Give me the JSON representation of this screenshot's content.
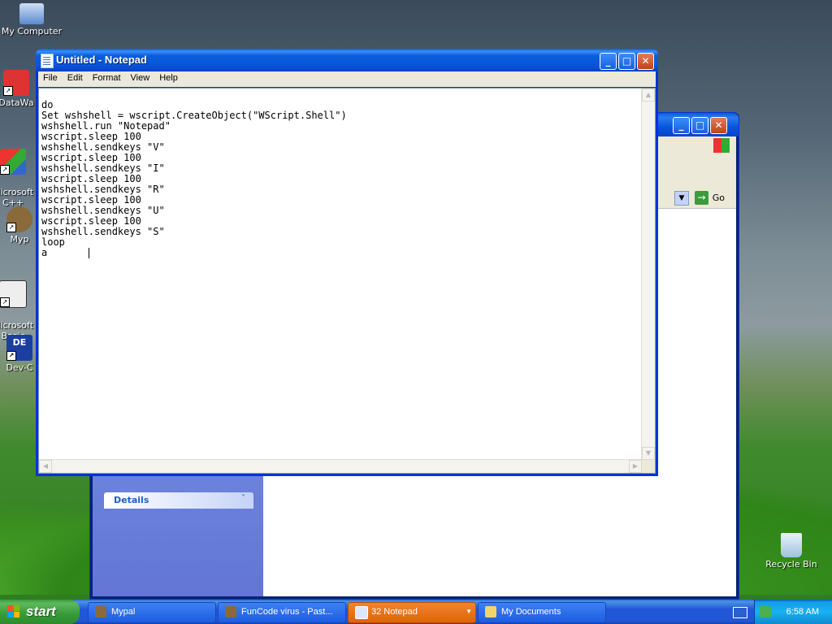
{
  "desktop": {
    "icons": [
      {
        "label": "My Computer"
      },
      {
        "label": "DataWa"
      },
      {
        "label": "Microsoft\nC++"
      },
      {
        "label": "Myp"
      },
      {
        "label": "Microsoft\nBasic"
      },
      {
        "label": "Dev-C"
      },
      {
        "label": "Recycle Bin"
      }
    ]
  },
  "background_window": {
    "address_go": "Go",
    "details_label": "Details"
  },
  "notepad": {
    "title": "Untitled - Notepad",
    "menu": [
      "File",
      "Edit",
      "Format",
      "View",
      "Help"
    ],
    "text": "do\nSet wshshell = wscript.CreateObject(\"WScript.Shell\")\nwshshell.run \"Notepad\"\nwscript.sleep 100\nwshshell.sendkeys \"V\"\nwscript.sleep 100\nwshshell.sendkeys \"I\"\nwscript.sleep 100\nwshshell.sendkeys \"R\"\nwscript.sleep 100\nwshshell.sendkeys \"U\"\nwscript.sleep 100\nwshshell.sendkeys \"S\"\nloop\na       "
  },
  "taskbar": {
    "start_label": "start",
    "tasks": [
      {
        "label": "Mypal",
        "active": false
      },
      {
        "label": "FunCode virus - Past...",
        "active": false
      },
      {
        "label": "32 Notepad",
        "active": true
      },
      {
        "label": "My Documents",
        "active": false
      }
    ],
    "clock": "6:58 AM"
  },
  "colors": {
    "taskbar": "#2157d7",
    "start": "#379b37",
    "active_task": "#e0620a",
    "titlebar": "#0855dd"
  }
}
